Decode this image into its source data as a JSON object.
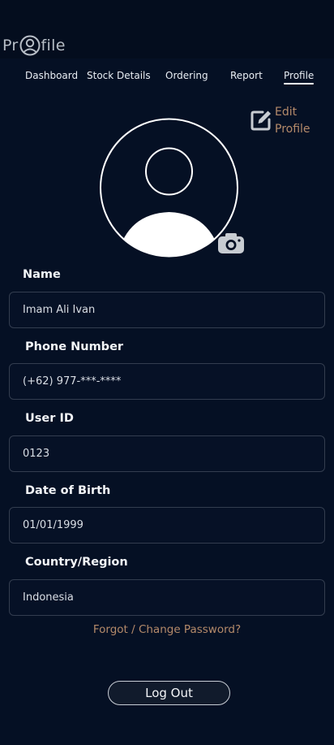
{
  "app": {
    "logo_left": "Pr",
    "logo_right": "file"
  },
  "nav": {
    "tabs": [
      {
        "label": "Dashboard",
        "active": false
      },
      {
        "label": "Stock Details",
        "active": false
      },
      {
        "label": "Ordering",
        "active": false
      },
      {
        "label": "Report",
        "active": false
      },
      {
        "label": "Profile",
        "active": true
      }
    ]
  },
  "edit_profile": {
    "line1": "Edit",
    "line2": "Profile"
  },
  "fields": [
    {
      "label": "Name",
      "value": "Imam Ali Ivan"
    },
    {
      "label": "Phone Number",
      "value": "(+62) 977-***-****"
    },
    {
      "label": "User ID",
      "value": "0123"
    },
    {
      "label": "Date of Birth",
      "value": "01/01/1999"
    },
    {
      "label": "Country/Region",
      "value": "Indonesia"
    }
  ],
  "forgot_password": "Forgot / Change Password?",
  "logout_label": "Log Out",
  "colors": {
    "background": "#051024",
    "accent": "#b48a6a",
    "text": "#e9edf3"
  },
  "icons": [
    "user-icon",
    "edit-icon",
    "avatar-placeholder-icon",
    "camera-icon"
  ]
}
